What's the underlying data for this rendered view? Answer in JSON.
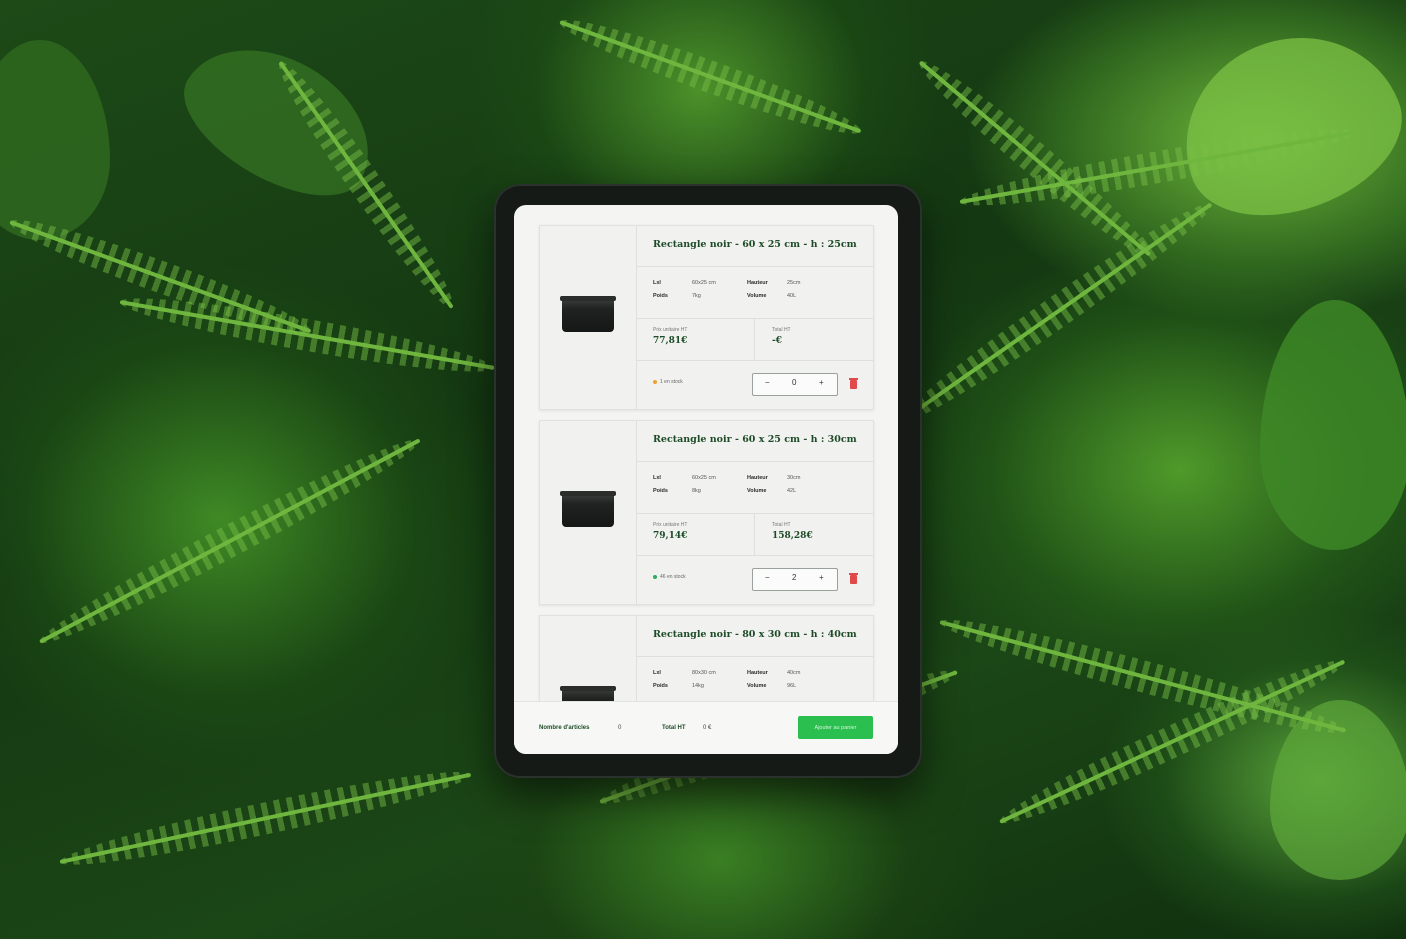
{
  "colors": {
    "brand_green": "#1e4b27",
    "cta_green": "#2bbf4f",
    "stock_low": "#f0a030",
    "stock_ok": "#2fae5a",
    "delete_red": "#e14a4a"
  },
  "products": [
    {
      "title": "Rectangle noir - 60 x 25 cm - h : 25cm",
      "specs": {
        "lxl_label": "Lxl",
        "lxl_value": "60x25 cm",
        "hauteur_label": "Hauteur",
        "hauteur_value": "25cm",
        "poids_label": "Poids",
        "poids_value": "7kg",
        "volume_label": "Volume",
        "volume_value": "40L"
      },
      "unit_price_label": "Prix unitaire HT",
      "unit_price": "77,81€",
      "total_label": "Total HT",
      "total": "-€",
      "stock_text": "1 en stock",
      "stock_icon": "stock-low-dot",
      "quantity": "0",
      "minus_label": "−",
      "plus_label": "+"
    },
    {
      "title": "Rectangle noir - 60 x 25 cm - h : 30cm",
      "specs": {
        "lxl_label": "Lxl",
        "lxl_value": "60x25 cm",
        "hauteur_label": "Hauteur",
        "hauteur_value": "30cm",
        "poids_label": "Poids",
        "poids_value": "8kg",
        "volume_label": "Volume",
        "volume_value": "42L"
      },
      "unit_price_label": "Prix unitaire HT",
      "unit_price": "79,14€",
      "total_label": "Total HT",
      "total": "158,28€",
      "stock_text": "46 en stock",
      "stock_icon": "stock-ok-dot",
      "quantity": "2",
      "minus_label": "−",
      "plus_label": "+"
    },
    {
      "title": "Rectangle noir - 80 x 30 cm - h : 40cm",
      "specs": {
        "lxl_label": "Lxl",
        "lxl_value": "80x30 cm",
        "hauteur_label": "Hauteur",
        "hauteur_value": "40cm",
        "poids_label": "Poids",
        "poids_value": "14kg",
        "volume_label": "Volume",
        "volume_value": "96L"
      }
    }
  ],
  "footer": {
    "count_label": "Nombre d'articles",
    "count_value": "0",
    "total_label": "Total HT",
    "total_value": "0 €",
    "cta_label": "Ajouter au panier"
  }
}
